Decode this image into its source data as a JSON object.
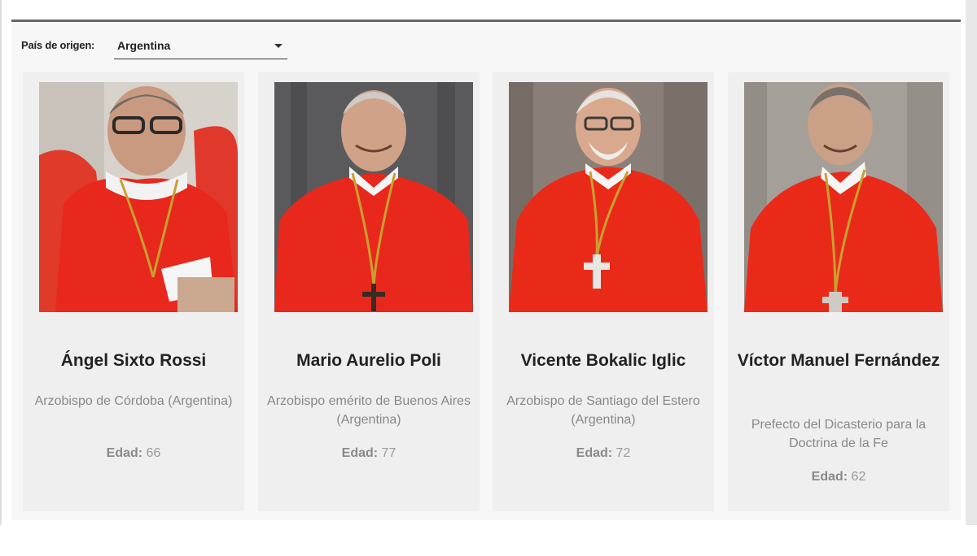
{
  "filter": {
    "label": "País de origen:",
    "selected": "Argentina"
  },
  "age_label": "Edad:",
  "cardinals": [
    {
      "name": "Ángel Sixto Rossi",
      "role": "Arzobispo de Córdoba (Argentina)",
      "age": "66"
    },
    {
      "name": "Mario Aurelio Poli",
      "role": "Arzobispo emérito de Buenos Aires (Argentina)",
      "age": "77"
    },
    {
      "name": "Vicente Bokalic Iglic",
      "role": "Arzobispo de Santiago del Estero (Argentina)",
      "age": "72"
    },
    {
      "name": "Víctor Manuel Fernández",
      "role": "Prefecto del Dicasterio para la Doctrina de la Fe",
      "age": "62"
    }
  ],
  "colors": {
    "vestment_red": "#e8281c",
    "card_bg": "#efefef",
    "name_text": "#222222",
    "muted_text": "#888888"
  }
}
